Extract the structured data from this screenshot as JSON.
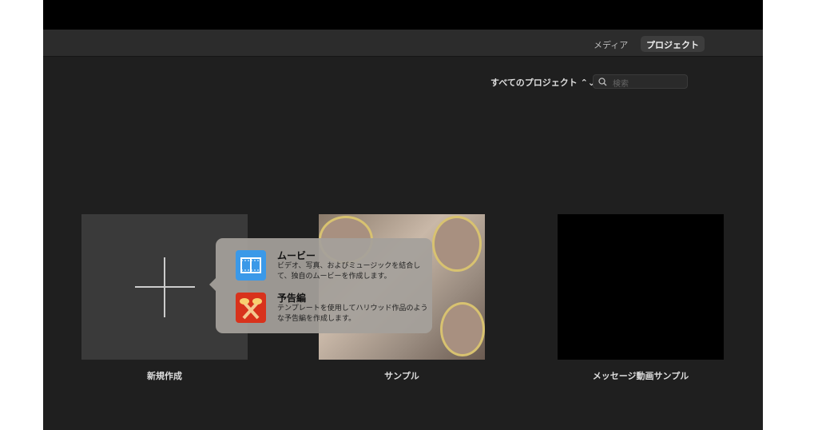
{
  "toolbar": {
    "tabs": [
      {
        "label": "メディア"
      },
      {
        "label": "プロジェクト",
        "selected": true
      }
    ]
  },
  "filter": {
    "label": "すべてのプロジェクト ⌃⌄"
  },
  "search": {
    "placeholder": "検索"
  },
  "projects": [
    {
      "label": "新規作成"
    },
    {
      "label": "サンプル"
    },
    {
      "label": "メッセージ動画サンプル"
    }
  ],
  "popover": {
    "items": [
      {
        "title": "ムービー",
        "description": "ビデオ、写真、およびミュージックを結合して、独自のムービーを作成します。",
        "icon_color": "#3b99e8"
      },
      {
        "title": "予告編",
        "description": "テンプレートを使用してハリウッド作品のような予告編を作成します。",
        "icon_color": "#d8321c"
      }
    ]
  }
}
